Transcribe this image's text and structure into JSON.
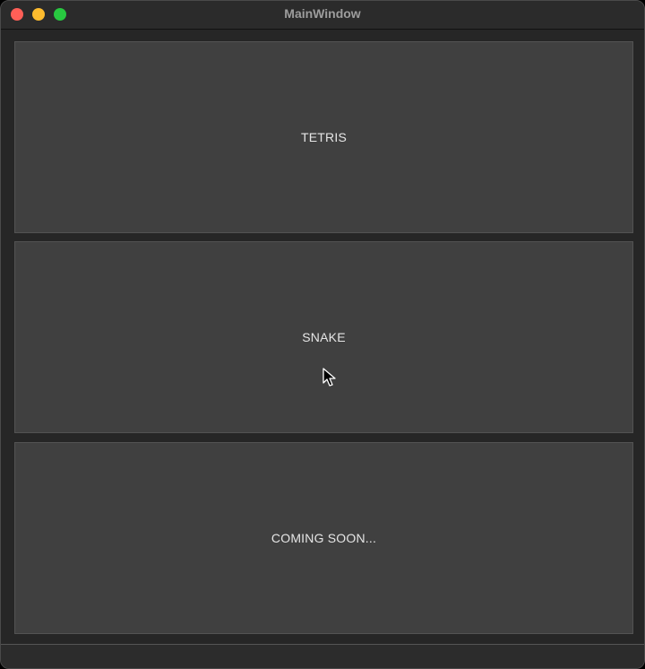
{
  "window": {
    "title": "MainWindow",
    "controls": [
      {
        "name": "close",
        "color": "#ff5f57"
      },
      {
        "name": "minimize",
        "color": "#febc2e"
      },
      {
        "name": "zoom",
        "color": "#28c840"
      }
    ]
  },
  "menu": {
    "buttons": [
      {
        "label": "TETRIS"
      },
      {
        "label": "SNAKE"
      },
      {
        "label": "COMING SOON..."
      }
    ]
  },
  "colors": {
    "button_background": "#404040",
    "window_background": "#262626",
    "text": "#e6e6e6"
  },
  "cursor": {
    "icon": "arrow-cursor-icon"
  }
}
